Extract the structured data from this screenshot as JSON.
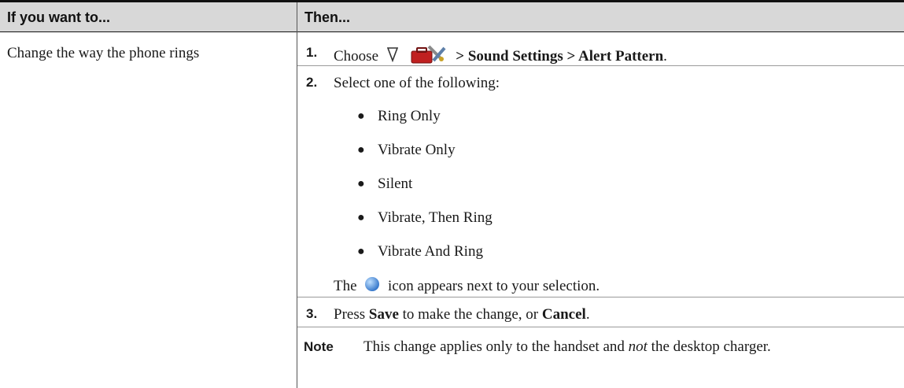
{
  "header": {
    "col1": "If you want to...",
    "col2": "Then..."
  },
  "task": "Change the way the phone rings",
  "steps": [
    {
      "num": "1.",
      "prefix": "Choose",
      "path": "> Sound Settings > Alert Pattern",
      "suffix": "."
    },
    {
      "num": "2.",
      "text": "Select one of the following:"
    },
    {
      "num": "3.",
      "pre": "Press",
      "save": "Save",
      "mid": "to make the change, or",
      "cancel": "Cancel",
      "post": "."
    }
  ],
  "options": [
    "Ring Only",
    "Vibrate Only",
    "Silent",
    "Vibrate, Then Ring",
    "Vibrate And Ring"
  ],
  "icon_sentence": {
    "pre": "The",
    "post": "icon appears next to your selection."
  },
  "note": {
    "label": "Note",
    "pre": "This change applies only to the handset and",
    "emph": "not",
    "post": "the desktop charger."
  },
  "icons": [
    "navigation-down-icon",
    "settings-toolbox-icon",
    "selected-option-icon"
  ],
  "colors": {
    "header_bg": "#d8d8d8",
    "toolbox_red": "#c02020",
    "selection_blue": "#2f72c8"
  }
}
